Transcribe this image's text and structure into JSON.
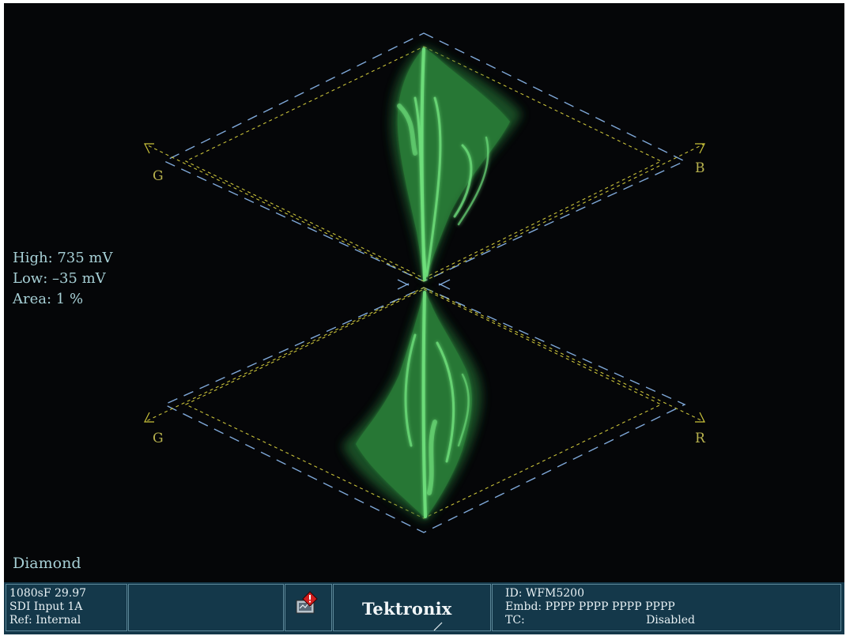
{
  "scope": {
    "mode": "Diamond",
    "axis_labels": {
      "upper_left": "G",
      "upper_right": "B",
      "lower_left": "G",
      "lower_right": "R"
    },
    "readouts": {
      "high": "High: 735 mV",
      "low": "Low: –35 mV",
      "area": "Area:  1 %"
    },
    "colors": {
      "trace": "#5fd96a",
      "graticule_outer": "#7fa8d8",
      "graticule_inner": "#c9c23a",
      "axis_label": "#b8b24e",
      "readout_text": "#a7d0d6"
    }
  },
  "status": {
    "format": "1080sF 29.97",
    "input": "SDI Input 1A",
    "reference": "Ref: Internal",
    "alarm_icon": "alarm-warning-icon",
    "brand": "Tektronix",
    "instrument_id": "ID: WFM5200",
    "embedded_audio": "Embd: PPPP PPPP PPPP PPPP",
    "timecode_label": "TC:",
    "timecode_value": "Disabled"
  }
}
